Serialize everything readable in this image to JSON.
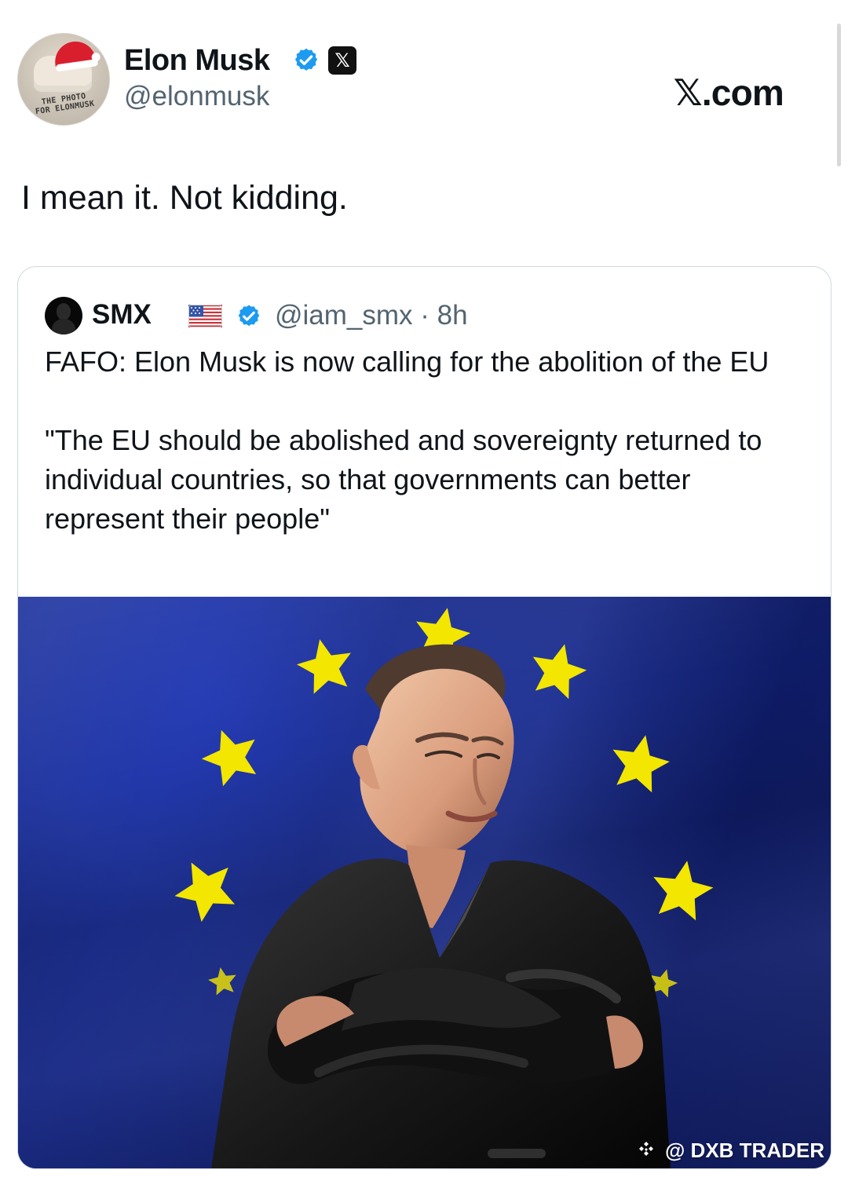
{
  "author": {
    "name": "Elon Musk",
    "handle": "@elonmusk",
    "avatar_caption": "THE PHOTO\nFOR ELONMUSK",
    "verified_icon": "verified-badge-icon",
    "platform_icon": "x-logo-icon",
    "platform_badge_text": "𝕏"
  },
  "site": {
    "label": "𝕏.com"
  },
  "tweet": {
    "text": "I mean it. Not kidding."
  },
  "quoted_tweet": {
    "author_name": "SMX",
    "flag_icon": "us-flag-icon",
    "verified_icon": "verified-badge-icon",
    "handle_time": "@iam_smx · 8h",
    "text": "FAFO: Elon Musk is now calling for the abolition of the EU\n\n\"The EU should be abolished and sovereignty returned to individual countries, so that governments can better represent their people\"",
    "image_watermark": "@ DXB TRADER"
  },
  "colors": {
    "text_primary": "#0f1419",
    "text_secondary": "#536471",
    "verified": "#1d9bf0",
    "card_border": "#cfd9de",
    "eu_blue": "#1a32ad",
    "eu_star": "#f3e600"
  }
}
